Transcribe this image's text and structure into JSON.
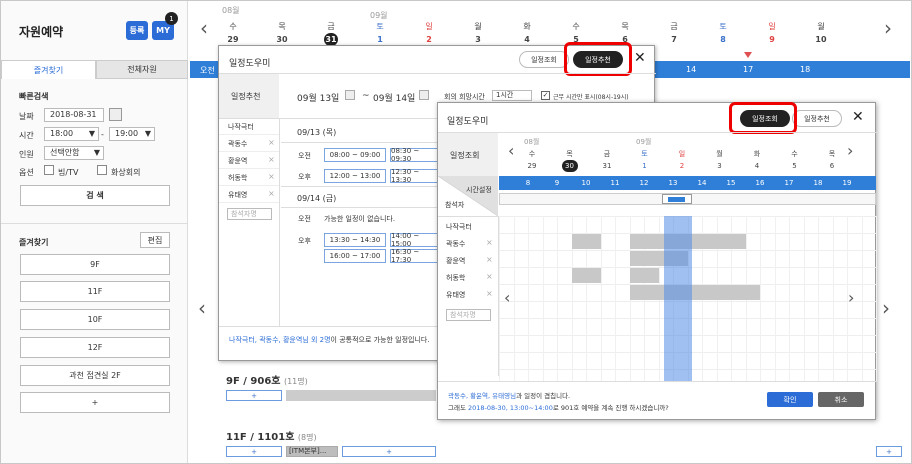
{
  "app_title": "자원예약",
  "header_buttons": {
    "register": "등록",
    "my": "MY",
    "my_count": "1"
  },
  "sidebar_tabs": [
    {
      "label": "즐겨찾기",
      "active": true
    },
    {
      "label": "전체자원",
      "active": false
    }
  ],
  "quick_search": {
    "title": "빠른검색",
    "date_label": "날짜",
    "date_value": "2018-08-31",
    "time_label": "시간",
    "time_start": "18:00",
    "time_sep": "-",
    "time_end": "19:00",
    "people_label": "인원",
    "people_value": "선택안함",
    "option_label": "옵션",
    "option_items": [
      "빔/TV",
      "화상회의"
    ],
    "search_button": "검 색"
  },
  "favorites": {
    "title": "즐겨찾기",
    "edit_button": "편집",
    "items": [
      "9F",
      "11F",
      "10F",
      "12F",
      "과천 접견실 2F",
      "+"
    ]
  },
  "calendar_bg": {
    "month_top": "08월",
    "month_top2": "09월",
    "weekdays": [
      "수",
      "목",
      "금",
      "토",
      "일",
      "월",
      "화",
      "수",
      "목",
      "금",
      "토",
      "일",
      "월"
    ],
    "days": [
      "29",
      "30",
      "31",
      "1",
      "2",
      "3",
      "4",
      "5",
      "6",
      "7",
      "8",
      "9",
      "10"
    ],
    "hours_visible": [
      "오전",
      "17",
      "18",
      "14"
    ]
  },
  "rooms_bg": [
    {
      "name": "9F / 906호",
      "count": "(11명)",
      "slot_plus": "+"
    },
    {
      "name": "11F / 1101호",
      "count": "(8명)",
      "slot_plus": "+",
      "busy": "[ITM본부]..."
    }
  ],
  "dialog_recommend": {
    "title": "일정도우미",
    "btn_view": "일정조회",
    "btn_recommend": "일정추천",
    "section_label": "일정추천",
    "range_start": "09월 13일",
    "range_sep": "~",
    "range_end": "09월 14일",
    "meeting_time_label": "회의 희망시간",
    "meeting_time_value": "1시간",
    "work_hours_check": "근무 시간만 표시(08시-19시)",
    "people": [
      "나작극터",
      "곽동수",
      "황윤역",
      "허동학",
      "유태영"
    ],
    "people_placeholder": "참석자명",
    "day1": "09/13 (목)",
    "am": "오전",
    "pm": "오후",
    "day1_am_slots": [
      "08:00 ~ 09:00",
      "08:30 ~ 09:30"
    ],
    "day1_pm_slots": [
      "12:00 ~ 13:00",
      "12:30 ~ 13:30"
    ],
    "day2": "09/14 (금)",
    "day2_am_text": "가능한 일정이 없습니다.",
    "day2_pm_slots": [
      "13:30 ~ 14:30",
      "14:00 ~ 15:00",
      "16:00 ~ 17:00",
      "16:30 ~ 17:30"
    ],
    "footer_names": "나작극터, 곽동수, 황윤역님 외 2명",
    "footer_text": "이 공통적으로 가능한 일정입니다."
  },
  "dialog_view": {
    "title": "일정도우미",
    "btn_view": "일정조회",
    "btn_recommend": "일정추천",
    "section_label": "일정조회",
    "month_a": "08월",
    "month_b": "09월",
    "weekdays": [
      "수",
      "목",
      "금",
      "토",
      "일",
      "월",
      "화",
      "수",
      "목"
    ],
    "days": [
      "29",
      "30",
      "31",
      "1",
      "2",
      "3",
      "4",
      "5",
      "6"
    ],
    "time_setting": "시간설정",
    "attendee_label": "참석자",
    "hours": [
      "8",
      "9",
      "10",
      "11",
      "12",
      "13",
      "14",
      "15",
      "16",
      "17",
      "18",
      "19"
    ],
    "people": [
      "나작극터",
      "곽동수",
      "황윤역",
      "허동학",
      "유태영"
    ],
    "people_placeholder": "참석자명",
    "footer_line1_names": "곽동수, 황윤역, 유태영님",
    "footer_line1_text": "과 일정이 겹칩니다.",
    "footer_line2_pre": "그래도 ",
    "footer_line2_link": "2018-08-30, 13:00~14:00",
    "footer_line2_post": "로 901호 예약을 계속 진행 하시겠습니까?",
    "confirm": "확인",
    "cancel": "취소"
  },
  "colors": {
    "accent": "#2b6cd6",
    "highlight_red": "#e00000",
    "bar_blue": "#2f7fd8"
  }
}
